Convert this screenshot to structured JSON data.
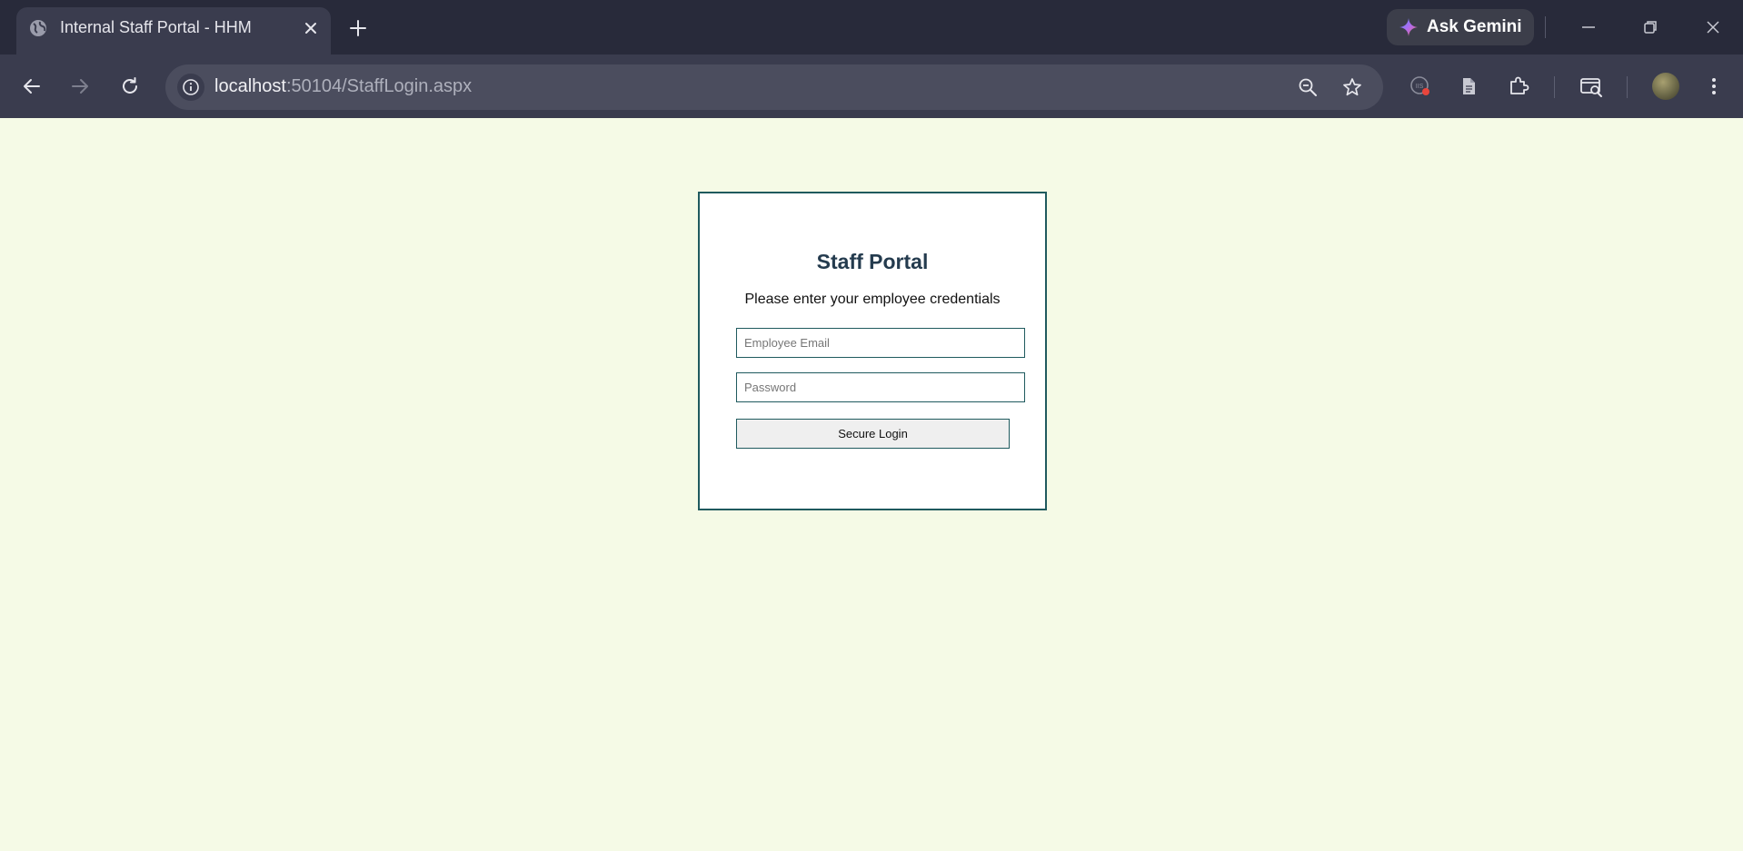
{
  "browser": {
    "tab": {
      "title": "Internal Staff Portal - HHM",
      "favicon": "globe-icon"
    },
    "ask_gemini_label": "Ask Gemini",
    "address": {
      "host": "localhost",
      "rest": ":50104/StaffLogin.aspx"
    }
  },
  "login": {
    "title": "Staff Portal",
    "subtitle": "Please enter your employee credentials",
    "email_placeholder": "Employee Email",
    "email_value": "",
    "password_placeholder": "Password",
    "password_value": "",
    "submit_label": "Secure Login"
  },
  "colors": {
    "page_background": "#f5fae6",
    "card_border": "#1f5a5e",
    "title_text": "#243b4e",
    "browser_frame": "#282a3a",
    "toolbar": "#3a3c4e"
  }
}
